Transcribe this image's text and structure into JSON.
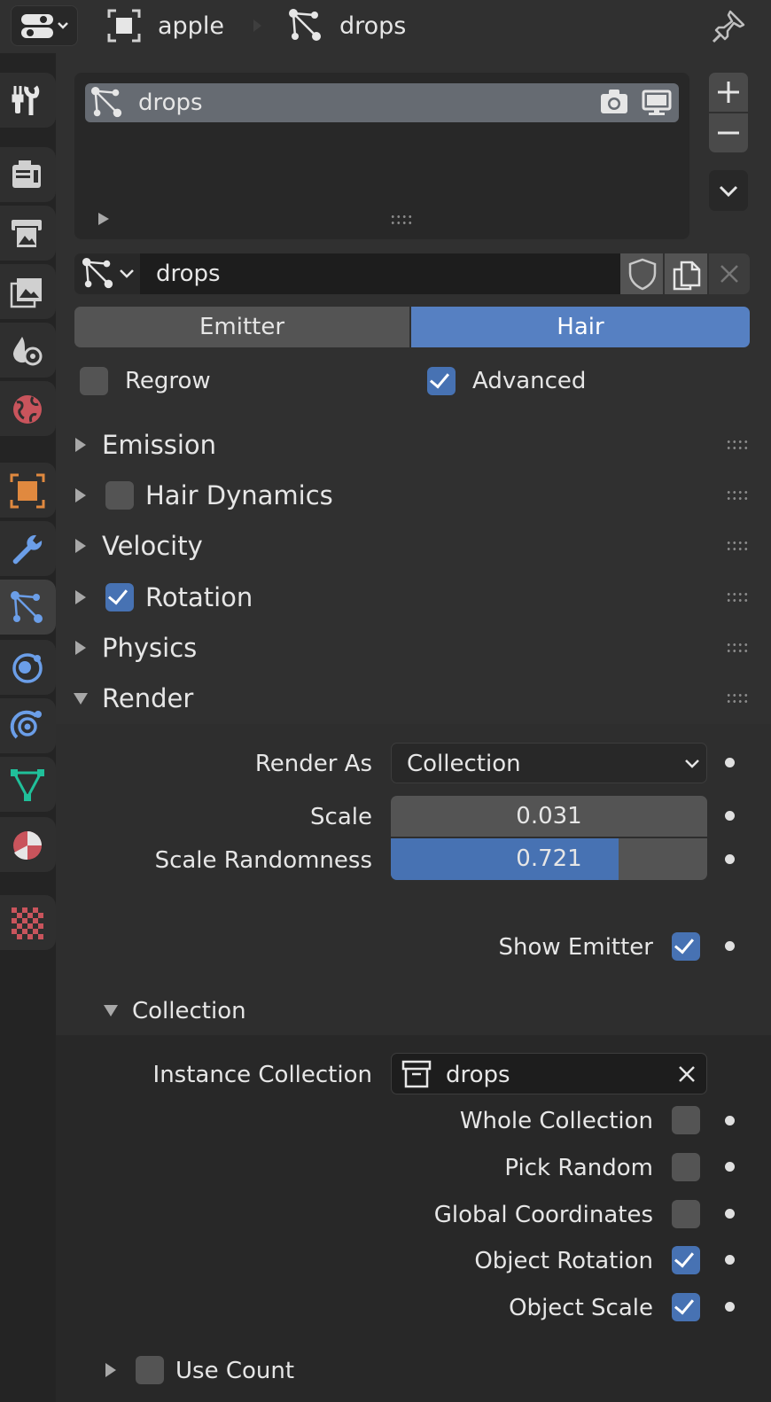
{
  "header": {
    "object_name": "apple",
    "particle_name": "drops"
  },
  "particle_list": {
    "items": [
      {
        "label": "drops"
      }
    ]
  },
  "datablock": {
    "name": "drops"
  },
  "type_tabs": {
    "emitter": "Emitter",
    "hair": "Hair",
    "selected": "Hair"
  },
  "options": {
    "regrow": {
      "label": "Regrow",
      "checked": false
    },
    "advanced": {
      "label": "Advanced",
      "checked": true
    }
  },
  "panels": {
    "emission": "Emission",
    "hair_dynamics": {
      "label": "Hair Dynamics",
      "checked": false
    },
    "velocity": "Velocity",
    "rotation": {
      "label": "Rotation",
      "checked": true
    },
    "physics": "Physics",
    "render": "Render"
  },
  "render": {
    "render_as_label": "Render As",
    "render_as_value": "Collection",
    "scale_label": "Scale",
    "scale_value": "0.031",
    "scale_random_label": "Scale Randomness",
    "scale_random_value": "0.721",
    "scale_random_fraction": 0.721,
    "show_emitter": {
      "label": "Show Emitter",
      "checked": true
    }
  },
  "collection": {
    "title": "Collection",
    "instance_label": "Instance Collection",
    "instance_value": "drops",
    "whole_collection": {
      "label": "Whole Collection",
      "checked": false
    },
    "pick_random": {
      "label": "Pick Random",
      "checked": false
    },
    "global_coordinates": {
      "label": "Global Coordinates",
      "checked": false
    },
    "object_rotation": {
      "label": "Object Rotation",
      "checked": true
    },
    "object_scale": {
      "label": "Object Scale",
      "checked": true
    }
  },
  "use_count": {
    "label": "Use Count",
    "checked": false
  },
  "colors": {
    "accent": "#4772b3",
    "selected_tab": "#5680c2",
    "bg": "#303030"
  },
  "icons": [
    "editor-type-icon",
    "object-icon",
    "particles-icon",
    "pin-icon",
    "camera-icon",
    "monitor-icon",
    "plus-icon",
    "minus-icon",
    "chevron-down-icon",
    "shield-icon",
    "duplicate-icon",
    "close-icon",
    "collection-icon"
  ]
}
